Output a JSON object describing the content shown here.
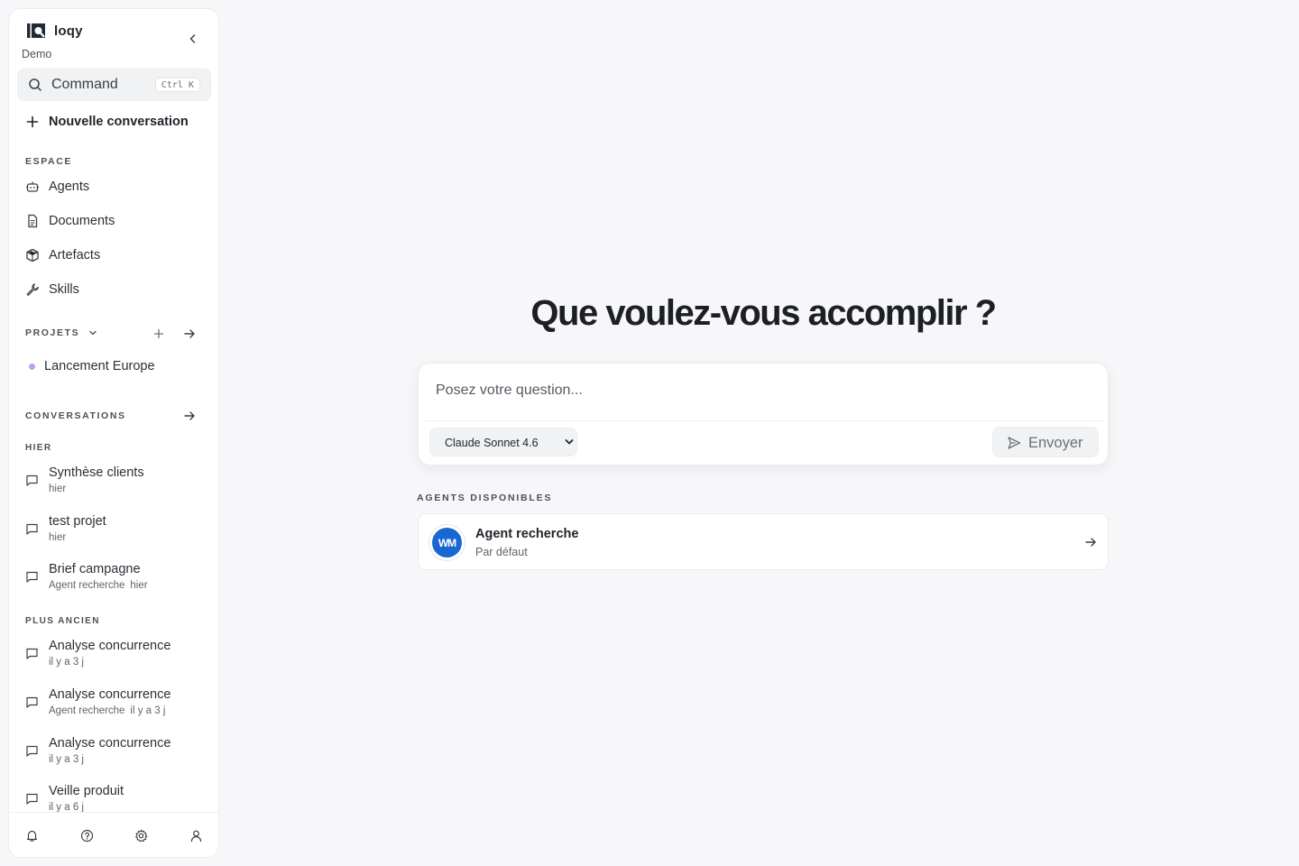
{
  "sidebar": {
    "brand_name": "loqy",
    "workspace": "Demo",
    "command": {
      "label": "Command",
      "shortcut": "Ctrl K"
    },
    "new_conversation": "Nouvelle conversation",
    "espace": {
      "title": "ESPACE",
      "items": [
        {
          "label": "Agents",
          "icon": "bot-icon"
        },
        {
          "label": "Documents",
          "icon": "document-icon"
        },
        {
          "label": "Artefacts",
          "icon": "package-icon"
        },
        {
          "label": "Skills",
          "icon": "wrench-icon"
        }
      ]
    },
    "projets": {
      "title": "PROJETS",
      "items": [
        {
          "label": "Lancement Europe",
          "color": "#c59bee"
        }
      ]
    },
    "conversations": {
      "title": "CONVERSATIONS",
      "groups": [
        {
          "title": "HIER",
          "items": [
            {
              "title": "Synthèse clients",
              "agent": "",
              "time": "hier"
            },
            {
              "title": "test projet",
              "agent": "",
              "time": "hier"
            },
            {
              "title": "Brief campagne",
              "agent": "Agent recherche",
              "time": "hier"
            }
          ]
        },
        {
          "title": "PLUS ANCIEN",
          "items": [
            {
              "title": "Analyse concurrence",
              "agent": "",
              "time": "il y a 3 j"
            },
            {
              "title": "Analyse concurrence",
              "agent": "Agent recherche",
              "time": "il y a 3 j"
            },
            {
              "title": "Analyse concurrence",
              "agent": "",
              "time": "il y a 3 j"
            },
            {
              "title": "Veille produit",
              "agent": "",
              "time": "il y a 6 j"
            }
          ]
        }
      ]
    },
    "footer_icons": [
      "bell-icon",
      "help-icon",
      "settings-icon",
      "user-icon"
    ]
  },
  "main": {
    "title": "Que voulez-vous accomplir ?",
    "composer": {
      "placeholder": "Posez votre question...",
      "model": "Claude Sonnet 4.6",
      "send_label": "Envoyer"
    },
    "agents": {
      "title": "AGENTS DISPONIBLES",
      "items": [
        {
          "name": "Agent recherche",
          "subtitle": "Par défaut",
          "avatar_text": "WM",
          "avatar_color": "#1967d2"
        }
      ]
    }
  }
}
